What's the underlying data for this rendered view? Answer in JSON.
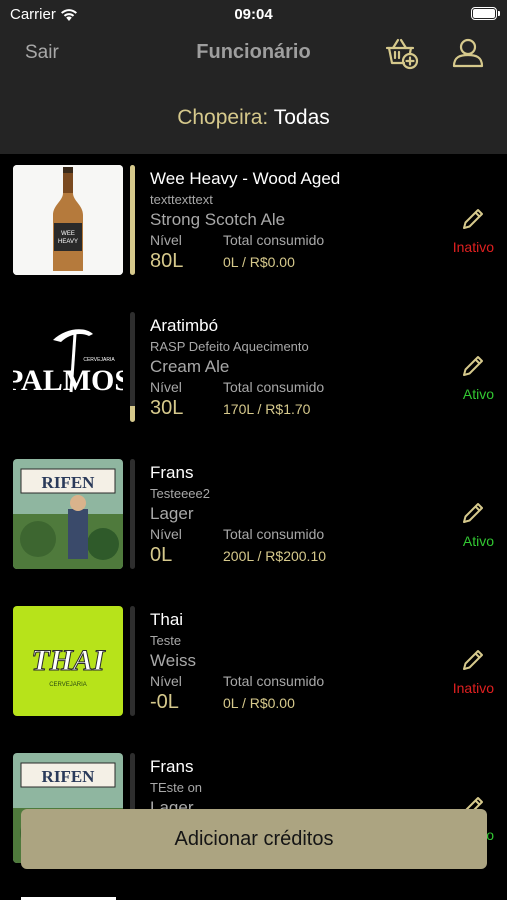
{
  "status_bar": {
    "carrier": "Carrier",
    "time": "09:04"
  },
  "nav": {
    "exit_label": "Sair",
    "title": "Funcionário",
    "cart_icon": "basket-plus-icon",
    "user_icon": "user-icon"
  },
  "filter": {
    "label": "Chopeira:",
    "value": "Todas"
  },
  "table": {
    "level_label": "Nível",
    "total_label": "Total consumido"
  },
  "beers": [
    {
      "name": "Wee Heavy - Wood Aged",
      "description": "texttexttext",
      "style": "Strong Scotch Ale",
      "level": "80L",
      "total": "0L / R$0.00",
      "status": "Inativo",
      "active": false,
      "fill": 1.0
    },
    {
      "name": "Aratimbó",
      "description": "RASP Defeito Aquecimento",
      "style": "Cream Ale",
      "level": "30L",
      "total": "170L / R$1.70",
      "status": "Ativo",
      "active": true,
      "fill": 0.15
    },
    {
      "name": "Frans",
      "description": "Testeeee2",
      "style": "Lager",
      "level": "0L",
      "total": "200L / R$200.10",
      "status": "Ativo",
      "active": true,
      "fill": 0
    },
    {
      "name": "Thai",
      "description": "Teste",
      "style": "Weiss",
      "level": "-0L",
      "total": "0L / R$0.00",
      "status": "Inativo",
      "active": false,
      "fill": 0
    },
    {
      "name": "Frans",
      "description": "TEste on",
      "style": "Lager",
      "level": "",
      "total": "",
      "status": "Ativo",
      "active": true,
      "fill": 0
    }
  ],
  "logos": {
    "palmos": "PALMOS",
    "palmos_small": "CERVEJARIA",
    "thai": "THAI",
    "thai_small": "CERVEJARIA",
    "rifen": "RIFEN",
    "wee": "WEE HEAVY"
  },
  "add_credits_label": "Adicionar créditos",
  "colors": {
    "accent": "#d6c98c",
    "button": "#aca481",
    "active": "#32c832",
    "inactive": "#e02020",
    "header_bg": "#242424"
  }
}
